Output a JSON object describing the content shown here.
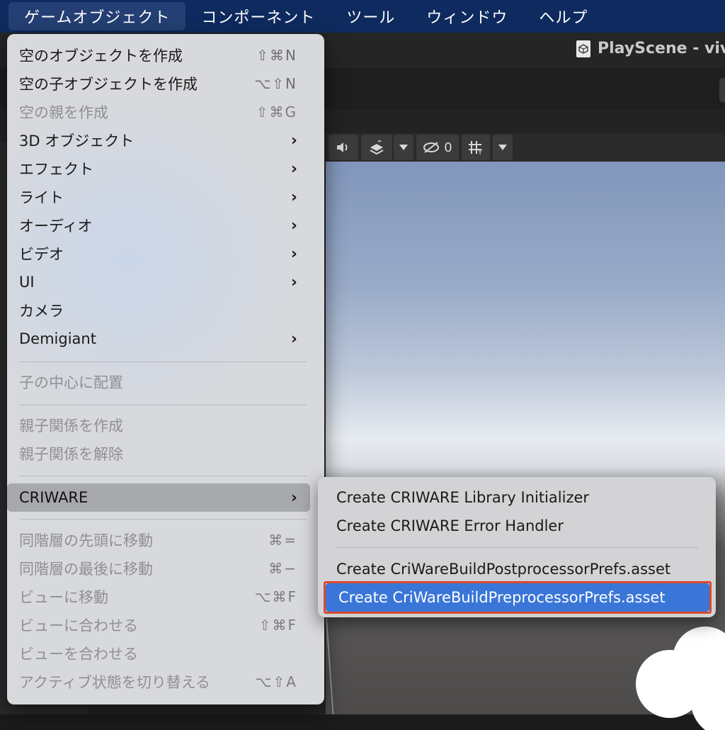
{
  "menubar": {
    "items": [
      "ゲームオブジェクト",
      "コンポーネント",
      "ツール",
      "ウィンドウ",
      "ヘルプ"
    ]
  },
  "window": {
    "title": "PlayScene - viv"
  },
  "scene_toolbar": {
    "hidden_count": "0"
  },
  "menu": {
    "items": [
      {
        "label": "空のオブジェクトを作成",
        "shortcut": "⇧⌘N",
        "enabled": true
      },
      {
        "label": "空の子オブジェクトを作成",
        "shortcut": "⌥⇧N",
        "enabled": true
      },
      {
        "label": "空の親を作成",
        "shortcut": "⇧⌘G",
        "enabled": false
      },
      {
        "label": "3D オブジェクト",
        "submenu": true,
        "enabled": true
      },
      {
        "label": "エフェクト",
        "submenu": true,
        "enabled": true
      },
      {
        "label": "ライト",
        "submenu": true,
        "enabled": true
      },
      {
        "label": "オーディオ",
        "submenu": true,
        "enabled": true
      },
      {
        "label": "ビデオ",
        "submenu": true,
        "enabled": true
      },
      {
        "label": "UI",
        "submenu": true,
        "enabled": true
      },
      {
        "label": "カメラ",
        "enabled": true
      },
      {
        "label": "Demigiant",
        "submenu": true,
        "enabled": true
      },
      {
        "label": "子の中心に配置",
        "enabled": false
      },
      {
        "label": "親子関係を作成",
        "enabled": false
      },
      {
        "label": "親子関係を解除",
        "enabled": false
      },
      {
        "label": "CRIWARE",
        "submenu": true,
        "enabled": true,
        "highlighted": true
      },
      {
        "label": "同階層の先頭に移動",
        "shortcut": "⌘=",
        "enabled": false
      },
      {
        "label": "同階層の最後に移動",
        "shortcut": "⌘−",
        "enabled": false
      },
      {
        "label": "ビューに移動",
        "shortcut": "⌥⌘F",
        "enabled": false
      },
      {
        "label": "ビューに合わせる",
        "shortcut": "⇧⌘F",
        "enabled": false
      },
      {
        "label": "ビューを合わせる",
        "enabled": false
      },
      {
        "label": "アクティブ状態を切り替える",
        "shortcut": "⌥⇧A",
        "enabled": false
      }
    ],
    "chevron": "›"
  },
  "submenu": {
    "items": [
      {
        "label": "Create CRIWARE Library Initializer"
      },
      {
        "label": "Create CRIWARE Error Handler"
      },
      {
        "label": "Create CriWareBuildPostprocessorPrefs.asset"
      },
      {
        "label": "Create CriWareBuildPreprocessorPrefs.asset",
        "selected": true
      }
    ]
  },
  "colors": {
    "menubar_bg": "#0e2a5e",
    "selection": "#3a76d8",
    "highlight_box": "#d84a2d"
  }
}
